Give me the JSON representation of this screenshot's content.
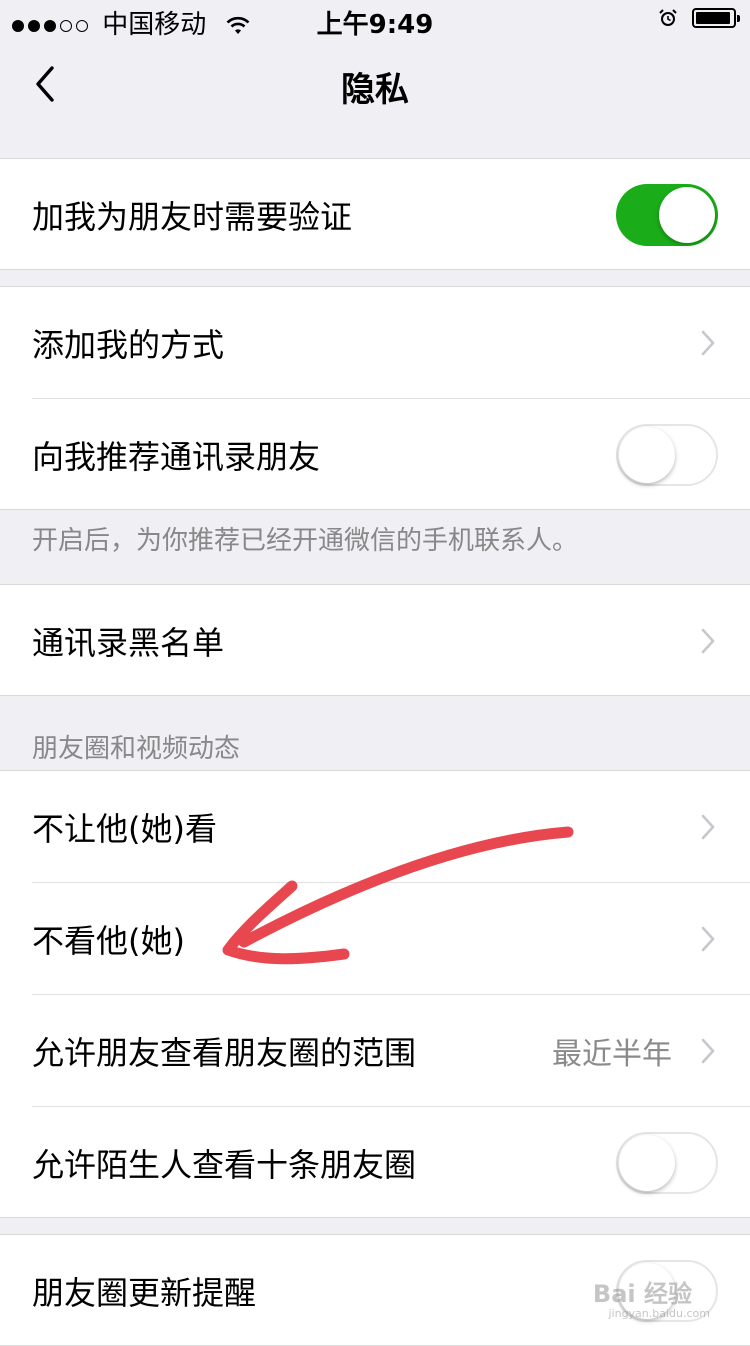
{
  "status_bar": {
    "carrier": "中国移动",
    "time": "上午9:49",
    "signal_icon": "signal-dots-icon",
    "wifi_icon": "wifi-icon",
    "alarm_icon": "alarm-icon",
    "battery_icon": "battery-icon"
  },
  "nav": {
    "title": "隐私",
    "back_icon": "chevron-left-icon"
  },
  "groups": {
    "verify": {
      "label": "加我为朋友时需要验证",
      "switch_on": true
    },
    "add_methods": {
      "label": "添加我的方式"
    },
    "recommend": {
      "label": "向我推荐通讯录朋友",
      "switch_on": false
    },
    "recommend_note": "开启后，为你推荐已经开通微信的手机联系人。",
    "blacklist": {
      "label": "通讯录黑名单"
    },
    "moments_header": "朋友圈和视频动态",
    "hide_from": {
      "label": "不让他(她)看"
    },
    "dont_see": {
      "label": "不看他(她)"
    },
    "range": {
      "label": "允许朋友查看朋友圈的范围",
      "value": "最近半年"
    },
    "strangers": {
      "label": "允许陌生人查看十条朋友圈",
      "switch_on": false
    },
    "update_remind": {
      "label": "朋友圈更新提醒"
    }
  },
  "colors": {
    "switch_on": "#1aad19",
    "annotation_arrow": "#e8474f",
    "background": "#efeff4"
  },
  "watermark": {
    "text": "Bai 经验",
    "sub": "jingyan.baidu.com"
  }
}
